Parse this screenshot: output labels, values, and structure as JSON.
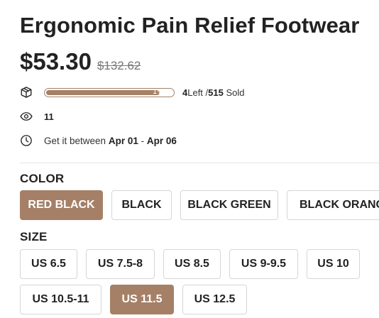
{
  "product": {
    "title": "Ergonomic Pain Relief Footwear",
    "price": "$53.30",
    "old_price": "$132.62"
  },
  "stock": {
    "icon": "package-icon",
    "progress_percent": 1,
    "progress_label": "1%",
    "left_count": "4",
    "left_label": "Left /",
    "sold_count": "515",
    "sold_label": "Sold"
  },
  "views": {
    "icon": "eye-icon",
    "count": "11"
  },
  "delivery": {
    "icon": "clock-icon",
    "prefix": "Get it between",
    "start": "Apr 01",
    "separator": "-",
    "end": "Apr 06"
  },
  "color": {
    "label": "COLOR",
    "selected": "RED BLACK",
    "options": [
      "RED BLACK",
      "BLACK",
      "BLACK GREEN",
      "BLACK ORANGE"
    ]
  },
  "size": {
    "label": "SIZE",
    "selected": "US 11.5",
    "options": [
      "US 6.5",
      "US 7.5-8",
      "US 8.5",
      "US 9-9.5",
      "US 10",
      "US 10.5-11",
      "US 11.5",
      "US 12.5"
    ]
  },
  "colors": {
    "accent": "#a58067",
    "text": "#222222",
    "border": "#d6d6d6"
  }
}
